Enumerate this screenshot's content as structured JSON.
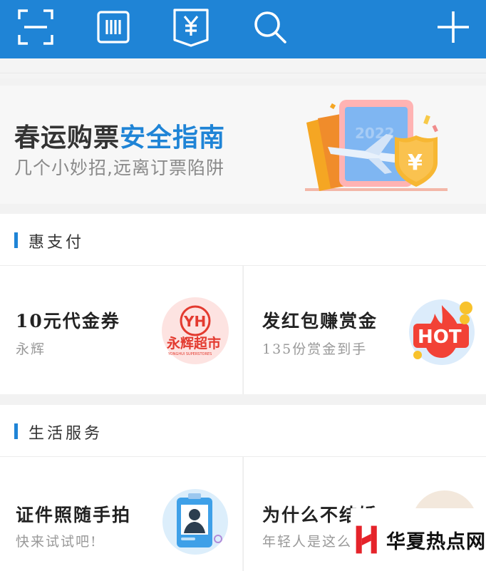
{
  "toolbar": {
    "icons": [
      "scan-icon",
      "barcode-icon",
      "payment-code-icon",
      "search-icon",
      "add-icon"
    ],
    "accent": "#1f84d6"
  },
  "banner": {
    "title_part1": "春运购票",
    "title_part2": "安全指南",
    "subtitle": "几个小妙招,远离订票陷阱",
    "image_text": "2022",
    "shield_symbol": "¥"
  },
  "section_pay": {
    "title": "惠支付",
    "cards": [
      {
        "title": "10元代金券",
        "subtitle": "永辉",
        "logo_text": "YH",
        "logo_caption": "永辉超市",
        "logo_small": "YONGHUI SUPERSTORES"
      },
      {
        "title": "发红包赚赏金",
        "subtitle": "135份赏金到手",
        "badge_text": "HOT"
      }
    ]
  },
  "section_life": {
    "title": "生活服务",
    "cards": [
      {
        "title": "证件照随手拍",
        "subtitle": "快来试试吧!"
      },
      {
        "title": "为什么不结婚",
        "subtitle": "年轻人是这么"
      }
    ]
  },
  "watermark": {
    "text": "华夏热点网",
    "brand_color": "#e5232a"
  }
}
